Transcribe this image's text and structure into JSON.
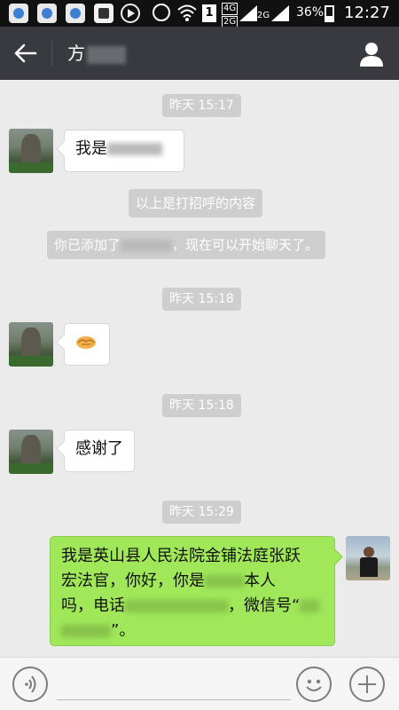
{
  "status_bar": {
    "app_icons": [
      "gallery-app-icon",
      "gallery-app-icon",
      "gallery-app-icon",
      "s-app-icon",
      "play-app-icon"
    ],
    "sim_label": "1",
    "network_top": "4G",
    "network_bottom": "2G",
    "network_second": "2G",
    "battery_percent": "36%",
    "battery_level": 0.36,
    "time": "12:27"
  },
  "header": {
    "title": "方",
    "back_icon": "arrow-left-icon",
    "profile_icon": "person-icon"
  },
  "chat": {
    "messages": [
      {
        "type": "time",
        "text": "昨天 15:17"
      },
      {
        "type": "incoming",
        "text_prefix": "我是",
        "text_suffix": ""
      },
      {
        "type": "system",
        "text": "以上是打招呼的内容"
      },
      {
        "type": "system",
        "text_prefix": "你已添加了",
        "text_suffix": "，现在可以开始聊天了。"
      },
      {
        "type": "time",
        "text": "昨天 15:18"
      },
      {
        "type": "incoming",
        "icon": "handshake-icon"
      },
      {
        "type": "time",
        "text": "昨天 15:18"
      },
      {
        "type": "incoming",
        "text": "感谢了"
      },
      {
        "type": "time",
        "text": "昨天 15:29"
      },
      {
        "type": "outgoing",
        "line1": "我是英山县人民法院金铺法庭张跃",
        "line2a": "宏法官，你好，你是",
        "line2b": "本人",
        "line3a": "吗，电话",
        "line3b": "，微信号“",
        "line4b": "”。"
      }
    ]
  },
  "input_bar": {
    "voice_icon": "voice-icon",
    "emoji_icon": "emoji-icon",
    "plus_icon": "plus-icon",
    "input_value": ""
  },
  "colors": {
    "status_bar": "#111111",
    "title_bar": "#393a3f",
    "chat_background": "#ebebeb",
    "outgoing_bubble": "#a0e75a",
    "incoming_bubble": "#ffffff",
    "system_pill": "#cecece"
  }
}
